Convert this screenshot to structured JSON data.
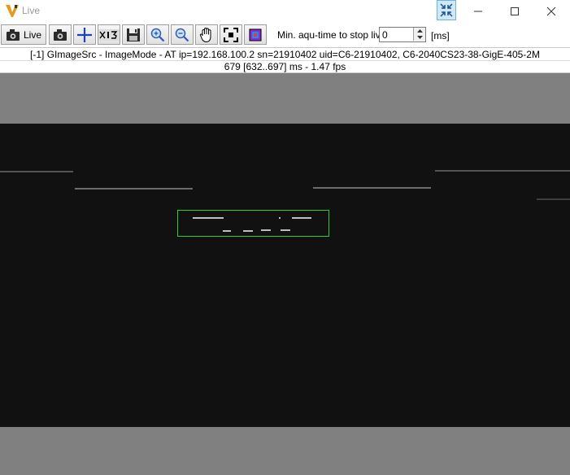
{
  "window": {
    "title": "Live",
    "controls": {
      "minimize": "—",
      "maximize": "☐",
      "close": "✕"
    }
  },
  "toolbar": {
    "live_label": "Live",
    "min_time_label": "Min. aqu-time to stop live",
    "min_time_value": "0",
    "unit_label": "[ms]",
    "icons": [
      "camera-live",
      "camera-snapshot",
      "crosshair",
      "zoom-13",
      "save",
      "zoom-in",
      "zoom-out",
      "hand-pan",
      "fit-screen",
      "settings-cube"
    ]
  },
  "info": {
    "line1": "[-1] GImageSrc - ImageMode - AT ip=192.168.100.2 sn=21910402 uid=C6-21910402, C6-2040CS23-38-GigE-405-2M",
    "line2": "679 [632..697] ms - 1.47 fps"
  },
  "colors": {
    "roi_outline": "#2ecc40",
    "viewport_bg": "#808080",
    "camera_bg": "#111111",
    "crosshair_blue": "#1e3fbf"
  }
}
